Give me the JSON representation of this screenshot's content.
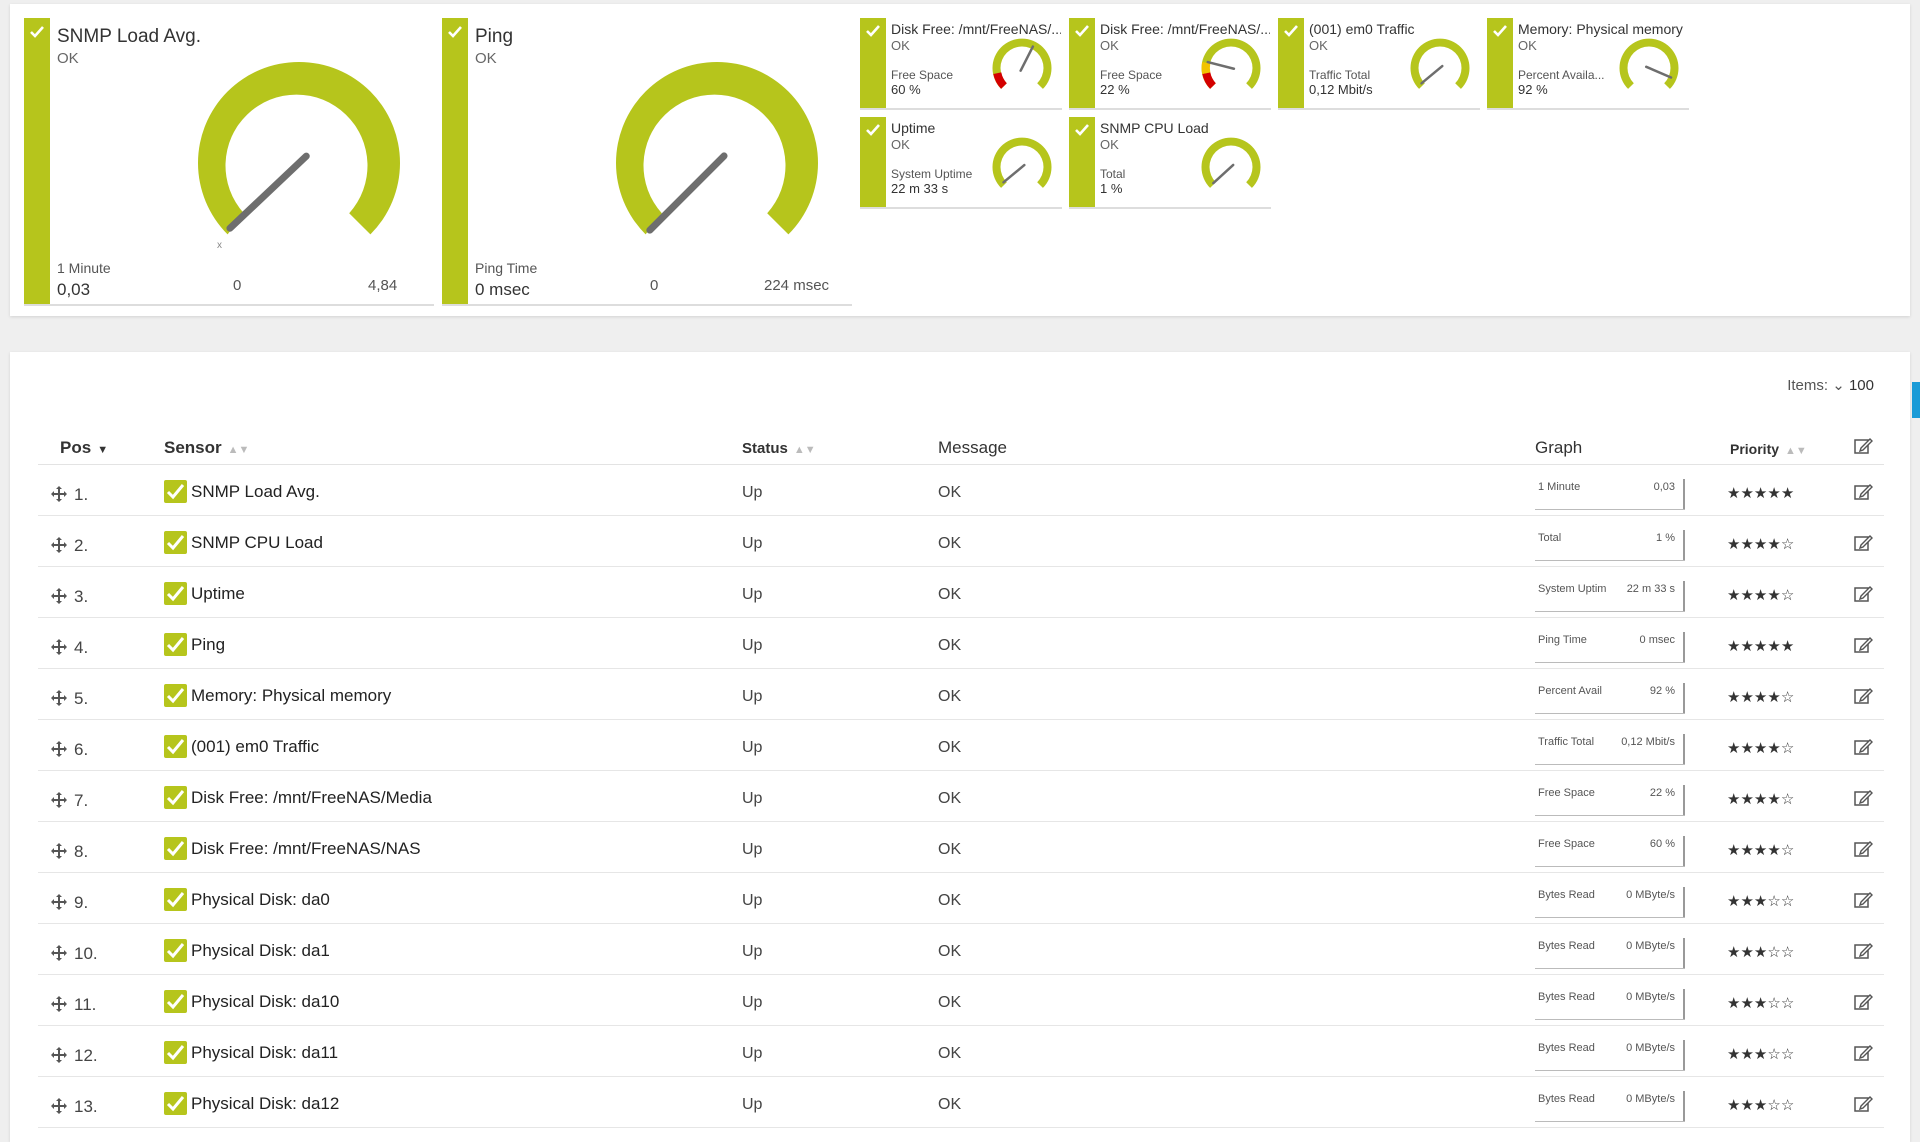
{
  "colors": {
    "ok_green": "#b6c51c",
    "needle": "#6e6e6e",
    "warn_yellow": "#f2c300",
    "error_red": "#d40000",
    "accent_blue": "#1a9bd7"
  },
  "big_gauges": [
    {
      "title": "SNMP Load Avg.",
      "status": "OK",
      "channel": "1 Minute",
      "value": "0,03",
      "min": "0",
      "max": "4,84",
      "level": 0.006
    },
    {
      "title": "Ping",
      "status": "OK",
      "channel": "Ping Time",
      "value": "0 msec",
      "min": "0",
      "max": "224 msec",
      "level": 0.0
    }
  ],
  "small_gauges": [
    {
      "title": "Disk Free: /mnt/FreeNAS/...",
      "status": "OK",
      "channel": "Free Space",
      "value": "60 %",
      "level": 0.6
    },
    {
      "title": "Disk Free: /mnt/FreeNAS/...",
      "status": "OK",
      "channel": "Free Space",
      "value": "22 %",
      "level": 0.22
    },
    {
      "title": "(001) em0 Traffic",
      "status": "OK",
      "channel": "Traffic Total",
      "value": "0,12 Mbit/s",
      "level": 0.02
    },
    {
      "title": "Memory: Physical memory",
      "status": "OK",
      "channel": "Percent Availa...",
      "value": "92 %",
      "level": 0.92
    },
    {
      "title": "Uptime",
      "status": "OK",
      "channel": "System Uptime",
      "value": "22 m 33 s",
      "level": 0.02
    },
    {
      "title": "SNMP CPU Load",
      "status": "OK",
      "channel": "Total",
      "value": "1 %",
      "level": 0.01
    }
  ],
  "table": {
    "items_label": "Items:",
    "items_count": "100",
    "headers": {
      "pos": "Pos",
      "sensor": "Sensor",
      "status": "Status",
      "message": "Message",
      "graph": "Graph",
      "priority": "Priority"
    },
    "rows": [
      {
        "pos": "1.",
        "sensor": "SNMP Load Avg.",
        "status": "Up",
        "message": "OK",
        "graph_label": "1 Minute",
        "graph_value": "0,03",
        "priority": 5
      },
      {
        "pos": "2.",
        "sensor": "SNMP CPU Load",
        "status": "Up",
        "message": "OK",
        "graph_label": "Total",
        "graph_value": "1 %",
        "priority": 4
      },
      {
        "pos": "3.",
        "sensor": "Uptime",
        "status": "Up",
        "message": "OK",
        "graph_label": "System Uptim",
        "graph_value": "22 m 33 s",
        "priority": 4
      },
      {
        "pos": "4.",
        "sensor": "Ping",
        "status": "Up",
        "message": "OK",
        "graph_label": "Ping Time",
        "graph_value": "0 msec",
        "priority": 5
      },
      {
        "pos": "5.",
        "sensor": "Memory: Physical memory",
        "status": "Up",
        "message": "OK",
        "graph_label": "Percent Avail",
        "graph_value": "92 %",
        "priority": 4
      },
      {
        "pos": "6.",
        "sensor": "(001) em0 Traffic",
        "status": "Up",
        "message": "OK",
        "graph_label": "Traffic Total",
        "graph_value": "0,12 Mbit/s",
        "priority": 4
      },
      {
        "pos": "7.",
        "sensor": "Disk Free: /mnt/FreeNAS/Media",
        "status": "Up",
        "message": "OK",
        "graph_label": "Free Space",
        "graph_value": "22 %",
        "priority": 4
      },
      {
        "pos": "8.",
        "sensor": "Disk Free: /mnt/FreeNAS/NAS",
        "status": "Up",
        "message": "OK",
        "graph_label": "Free Space",
        "graph_value": "60 %",
        "priority": 4
      },
      {
        "pos": "9.",
        "sensor": "Physical Disk: da0",
        "status": "Up",
        "message": "OK",
        "graph_label": "Bytes Read",
        "graph_value": "0 MByte/s",
        "priority": 3
      },
      {
        "pos": "10.",
        "sensor": "Physical Disk: da1",
        "status": "Up",
        "message": "OK",
        "graph_label": "Bytes Read",
        "graph_value": "0 MByte/s",
        "priority": 3
      },
      {
        "pos": "11.",
        "sensor": "Physical Disk: da10",
        "status": "Up",
        "message": "OK",
        "graph_label": "Bytes Read",
        "graph_value": "0 MByte/s",
        "priority": 3
      },
      {
        "pos": "12.",
        "sensor": "Physical Disk: da11",
        "status": "Up",
        "message": "OK",
        "graph_label": "Bytes Read",
        "graph_value": "0 MByte/s",
        "priority": 3
      },
      {
        "pos": "13.",
        "sensor": "Physical Disk: da12",
        "status": "Up",
        "message": "OK",
        "graph_label": "Bytes Read",
        "graph_value": "0 MByte/s",
        "priority": 3
      }
    ]
  }
}
